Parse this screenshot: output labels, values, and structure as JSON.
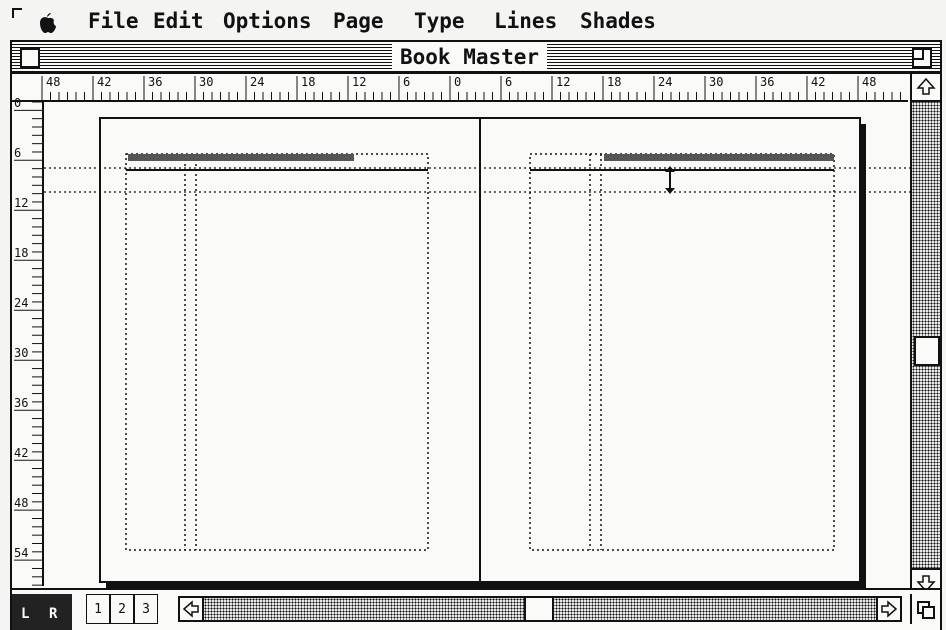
{
  "menubar": {
    "items": [
      "File",
      "Edit",
      "Options",
      "Page",
      "Type",
      "Lines",
      "Shades"
    ]
  },
  "window": {
    "title": "Book Master"
  },
  "hruler": {
    "labels": [
      "48",
      "42",
      "36",
      "30",
      "24",
      "18",
      "12",
      "6",
      "0",
      "6",
      "12",
      "18",
      "24",
      "30",
      "36",
      "42",
      "48"
    ]
  },
  "vruler": {
    "labels": [
      "0",
      "6",
      "12",
      "18",
      "24",
      "30",
      "36",
      "42",
      "48",
      "54"
    ]
  },
  "pages": {
    "left_label": "L",
    "right_label": "R",
    "buttons": [
      "1",
      "2",
      "3"
    ]
  },
  "icons": {
    "apple": "apple-icon",
    "close": "close-box-icon",
    "zoom": "zoom-box-icon",
    "scroll_up": "up-arrow-icon",
    "scroll_down": "down-arrow-icon",
    "scroll_left": "left-arrow-icon",
    "scroll_right": "right-arrow-icon",
    "resize_cursor": "vertical-resize-icon",
    "size_box": "size-box-icon"
  }
}
